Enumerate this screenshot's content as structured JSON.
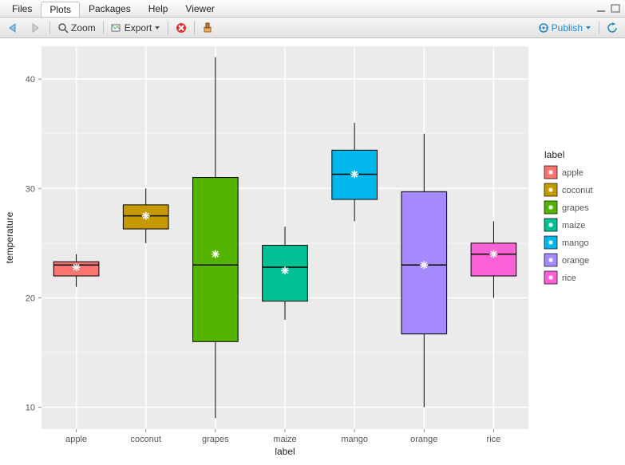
{
  "tabs": [
    "Files",
    "Plots",
    "Packages",
    "Help",
    "Viewer"
  ],
  "active_tab": "Plots",
  "toolbar": {
    "zoom": "Zoom",
    "export": "Export",
    "publish": "Publish"
  },
  "chart_data": {
    "type": "boxplot",
    "xlabel": "label",
    "ylabel": "temperature",
    "y_ticks": [
      10,
      20,
      30,
      40
    ],
    "ylim": [
      8,
      43
    ],
    "categories": [
      "apple",
      "coconut",
      "grapes",
      "maize",
      "mango",
      "orange",
      "rice"
    ],
    "legend": {
      "title": "label",
      "items": [
        {
          "name": "apple",
          "color": "#F8766D"
        },
        {
          "name": "coconut",
          "color": "#C49A00"
        },
        {
          "name": "grapes",
          "color": "#53B400"
        },
        {
          "name": "maize",
          "color": "#00C094"
        },
        {
          "name": "mango",
          "color": "#00B6EB"
        },
        {
          "name": "orange",
          "color": "#A58AFF"
        },
        {
          "name": "rice",
          "color": "#FB61D7"
        }
      ]
    },
    "boxes": [
      {
        "label": "apple",
        "whisker_low": 21.0,
        "q1": 22.0,
        "median": 23.0,
        "q3": 23.3,
        "whisker_high": 24.0,
        "mean": 22.8,
        "color": "#F8766D"
      },
      {
        "label": "coconut",
        "whisker_low": 25.0,
        "q1": 26.3,
        "median": 27.5,
        "q3": 28.5,
        "whisker_high": 30.0,
        "mean": 27.5,
        "color": "#C49A00"
      },
      {
        "label": "grapes",
        "whisker_low": 9.0,
        "q1": 16.0,
        "median": 23.0,
        "q3": 31.0,
        "whisker_high": 42.0,
        "mean": 24.0,
        "color": "#53B400"
      },
      {
        "label": "maize",
        "whisker_low": 18.0,
        "q1": 19.7,
        "median": 22.8,
        "q3": 24.8,
        "whisker_high": 26.5,
        "mean": 22.5,
        "color": "#00C094"
      },
      {
        "label": "mango",
        "whisker_low": 27.0,
        "q1": 29.0,
        "median": 31.3,
        "q3": 33.5,
        "whisker_high": 36.0,
        "mean": 31.3,
        "color": "#00B6EB"
      },
      {
        "label": "orange",
        "whisker_low": 10.0,
        "q1": 16.7,
        "median": 23.0,
        "q3": 29.7,
        "whisker_high": 35.0,
        "mean": 23.0,
        "color": "#A58AFF"
      },
      {
        "label": "rice",
        "whisker_low": 20.0,
        "q1": 22.0,
        "median": 24.0,
        "q3": 25.0,
        "whisker_high": 27.0,
        "mean": 24.0,
        "color": "#FB61D7"
      }
    ]
  }
}
